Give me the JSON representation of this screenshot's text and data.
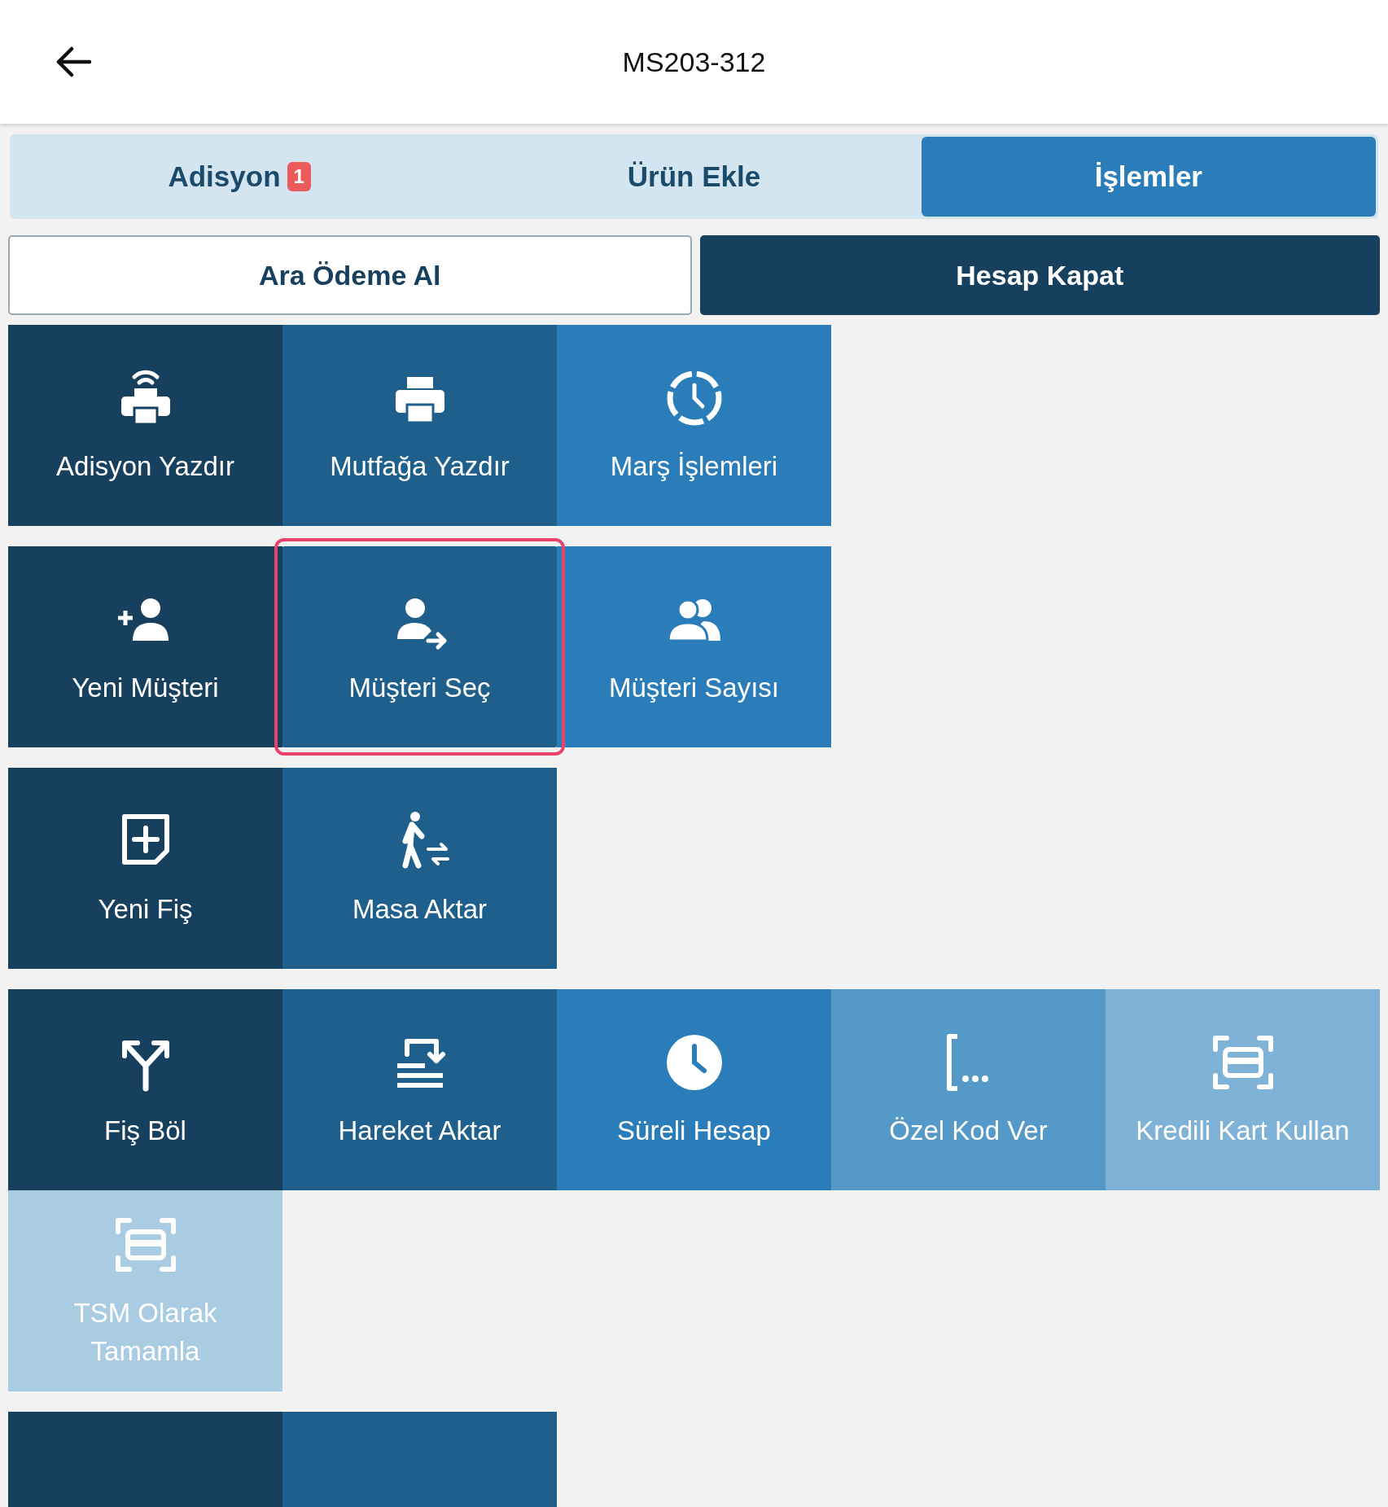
{
  "header": {
    "title": "MS203-312"
  },
  "tabs": [
    {
      "label": "Adisyon",
      "badge": "1",
      "selected": false
    },
    {
      "label": "Ürün Ekle",
      "selected": false
    },
    {
      "label": "İşlemler",
      "selected": true
    }
  ],
  "actions": [
    {
      "label": "Ara Ödeme Al",
      "kind": "outline"
    },
    {
      "label": "Hesap Kapat",
      "kind": "solid"
    }
  ],
  "tile_groups": [
    {
      "tiles": [
        {
          "label": "Adisyon Yazdır",
          "kind": "printer-wifi",
          "color": "#17405e",
          "selected": false
        },
        {
          "label": "Mutfağa Yazdır",
          "kind": "printer",
          "color": "#1f5f8b",
          "selected": false
        },
        {
          "label": "Marş İşlemleri",
          "kind": "clock-dashed",
          "color": "#2a7db8",
          "selected": false
        }
      ]
    },
    {
      "tiles": [
        {
          "label": "Yeni Müşteri",
          "kind": "user-plus",
          "color": "#17405e",
          "selected": false
        },
        {
          "label": "Müşteri Seç",
          "kind": "user-arrow",
          "color": "#1f5f8b",
          "selected": true
        },
        {
          "label": "Müşteri Sayısı",
          "kind": "users",
          "color": "#2a7db8",
          "selected": false
        }
      ]
    },
    {
      "tiles": [
        {
          "label": "Yeni Fiş",
          "kind": "note-plus",
          "color": "#17405e",
          "selected": false
        },
        {
          "label": "Masa Aktar",
          "kind": "walk-transfer",
          "color": "#1f5f8b",
          "selected": false
        }
      ]
    },
    {
      "tiles": [
        {
          "label": "Fiş Böl",
          "kind": "split",
          "color": "#17405e",
          "selected": false
        },
        {
          "label": "Hareket Aktar",
          "kind": "list-transfer",
          "color": "#1f5f8b",
          "selected": false
        },
        {
          "label": "Süreli Hesap",
          "kind": "clock",
          "color": "#2a7db8",
          "selected": false
        },
        {
          "label": "Özel Kod Ver",
          "kind": "bracket",
          "color": "#5599c9",
          "selected": false
        },
        {
          "label": "Kredili Kart Kullan",
          "kind": "card-scan",
          "color": "#7eb2d7",
          "selected": false
        },
        {
          "label": "TSM Olarak\nTamamla",
          "kind": "card-scan",
          "color": "#a9cce3",
          "selected": false
        }
      ]
    },
    {
      "tiles": [
        {
          "color": "#17405e",
          "selected": false
        },
        {
          "color": "#1f5f8b",
          "selected": false
        }
      ]
    }
  ]
}
